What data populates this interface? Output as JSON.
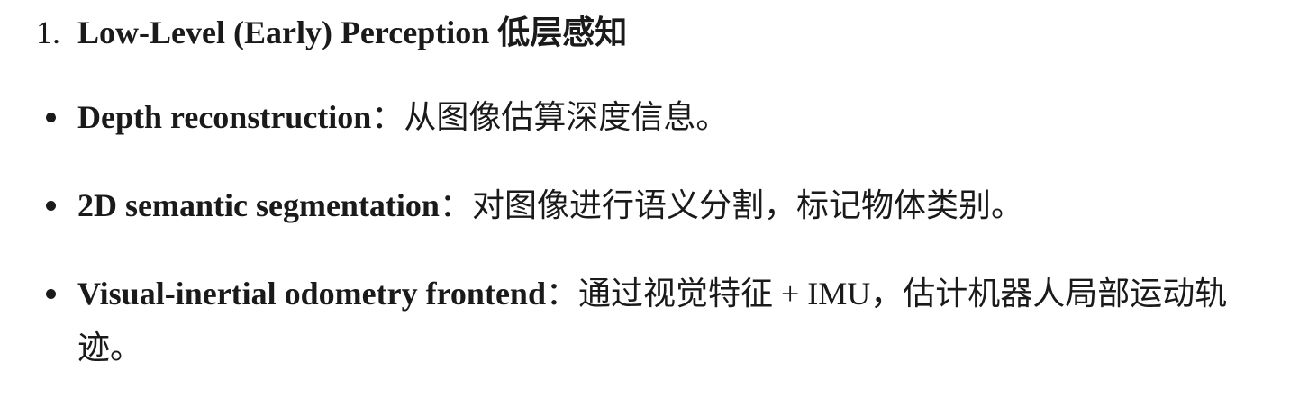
{
  "section": {
    "number": "1.",
    "title": "Low-Level (Early) Perception 低层感知"
  },
  "items": [
    {
      "term": "Depth reconstruction",
      "desc": "：从图像估算深度信息。"
    },
    {
      "term": "2D semantic segmentation",
      "desc": "：对图像进行语义分割，标记物体类别。"
    },
    {
      "term": "Visual-inertial odometry frontend",
      "desc": "：通过视觉特征 + IMU，估计机器人局部运动轨迹。"
    }
  ]
}
